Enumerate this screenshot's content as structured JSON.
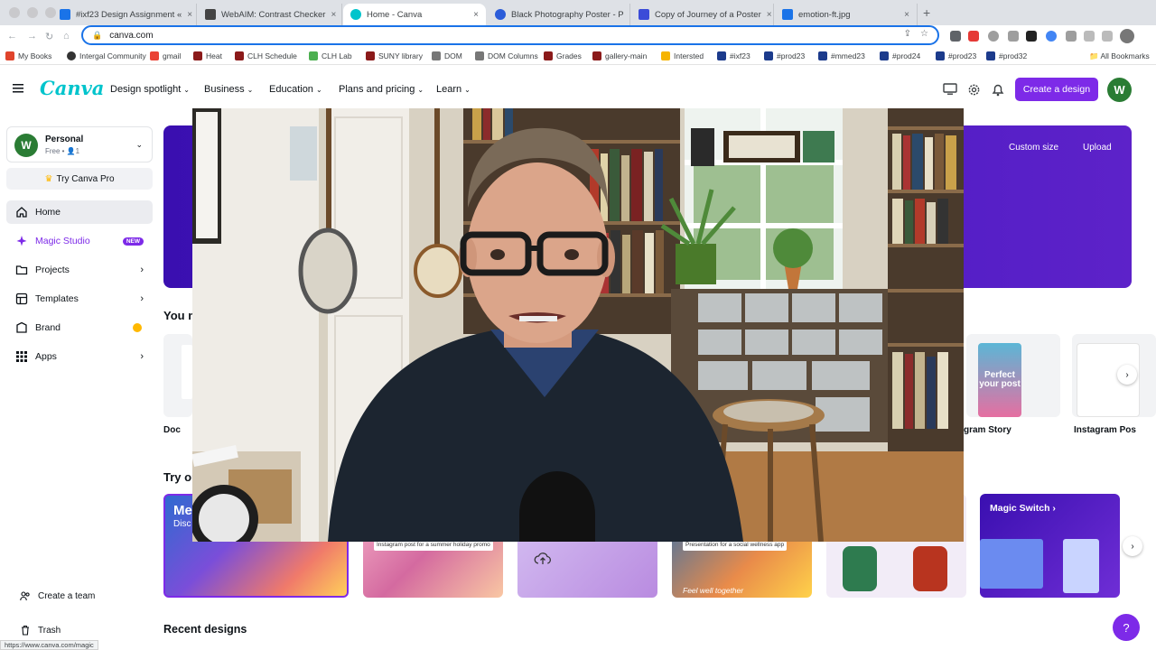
{
  "browser": {
    "tabs": [
      {
        "label": "#ixf23 Design Assignment «",
        "color": "#1a73e8",
        "active": false
      },
      {
        "label": "WebAIM: Contrast Checker",
        "color": "#444",
        "active": false
      },
      {
        "label": "Home - Canva",
        "color": "#00c4cc",
        "active": true
      },
      {
        "label": "Black Photography Poster - P",
        "color": "#2b5cd9",
        "active": false
      },
      {
        "label": "Copy of Journey of a Poster",
        "color": "#3b4bd8",
        "active": false
      },
      {
        "label": "emotion-ft.jpg",
        "color": "#1a73e8",
        "active": false
      }
    ],
    "url": "canva.com",
    "bookmarks": [
      "My Books",
      "Intergal Community",
      "gmail",
      "Heat",
      "CLH Schedule",
      "CLH Lab",
      "SUNY library",
      "DOM",
      "DOM Columns",
      "Grades",
      "gallery-main",
      "Intersted",
      "#ixf23",
      "#prod23",
      "#mmed23",
      "#prod24",
      "#prod23",
      "#prod32"
    ],
    "all_bookmarks": "All Bookmarks",
    "status_url": "https://www.canva.com/magic"
  },
  "header": {
    "logo": "Canva",
    "nav": [
      "Design spotlight",
      "Business",
      "Education",
      "Plans and pricing",
      "Learn"
    ],
    "create_label": "Create a design",
    "avatar_initial": "W"
  },
  "sidebar": {
    "account_name": "Personal",
    "account_sub": "Free • 👤1",
    "avatar_initial": "W",
    "try_pro": "Try Canva Pro",
    "items": [
      {
        "label": "Home",
        "icon": "home-icon"
      },
      {
        "label": "Magic Studio",
        "badge": "NEW",
        "icon": "sparkle-icon"
      },
      {
        "label": "Projects",
        "icon": "folder-icon"
      },
      {
        "label": "Templates",
        "icon": "templates-icon"
      },
      {
        "label": "Brand",
        "icon": "brand-icon"
      },
      {
        "label": "Apps",
        "icon": "apps-icon"
      }
    ],
    "create_team": "Create a team",
    "trash": "Trash"
  },
  "main": {
    "hero_buttons": [
      "Custom size",
      "Upload"
    ],
    "you_might_title": "You m",
    "cards": [
      "Doc",
      "gram Story",
      "Instagram Pos"
    ],
    "story_thumb_text": "Perfect your post",
    "try_title": "Try ou",
    "promo_captions": [
      "Instagram post for a summer holiday promo",
      "Presentation for a social wellness app"
    ],
    "promo_first_text": "Me",
    "promo_first_sub": "Disc",
    "feel_text": "Feel well together",
    "magic_switch": "Magic Switch ›",
    "recent": "Recent designs"
  },
  "colors": {
    "brand_purple": "#7d2ae8",
    "canva_teal": "#00c4cc"
  }
}
